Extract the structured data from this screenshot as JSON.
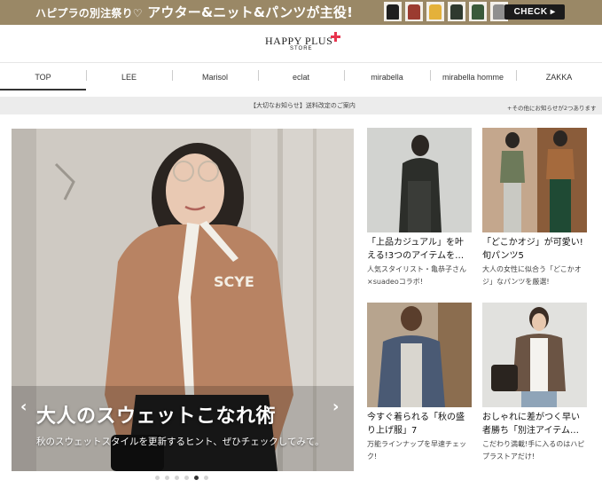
{
  "promo": {
    "lead": "ハピプラの別注祭り♡",
    "main": "アウター&ニット&パンツが主役!",
    "check_label": "CHECK ▸",
    "thumb_colors": [
      "#1f1f1f",
      "#9b3b30",
      "#e4b13a",
      "#2f3a2f",
      "#3a5a3a",
      "#8f8f8f"
    ]
  },
  "logo": {
    "main": "HAPPY PLUS",
    "sub": "STORE",
    "accent_color": "#e8344e"
  },
  "nav": {
    "items": [
      "TOP",
      "LEE",
      "Marisol",
      "eclat",
      "mirabella",
      "mirabella homme",
      "ZAKKA"
    ],
    "active": "TOP"
  },
  "notice": {
    "main": "【大切なお知らせ】送料改定のご案内",
    "more": "+その他にお知らせが2つあります"
  },
  "hero": {
    "title": "大人のスウェットこなれ術",
    "subtitle": "秋のスウェットスタイルを更新するヒント、ぜひチェックしてみて。",
    "logo_print": "SCYE",
    "slide_count": 6,
    "active_slide": 5
  },
  "cards": [
    {
      "title": "「上品カジュアル」を叶える!3つのアイテムを…",
      "desc": "人気スタイリスト・亀恭子さん×suadeoコラボ!"
    },
    {
      "title": "「どこかオジ」が可愛い! 旬パンツ5",
      "desc": "大人の女性に似合う「どこかオジ」なパンツを厳選!"
    },
    {
      "title": "今すぐ着られる「秋の盛り上げ服」7",
      "desc": "万能ラインナップを早速チェック!"
    },
    {
      "title": "おしゃれに差がつく早い者勝ち「別注アイテム…",
      "desc": "こだわり満載!手に入るのはハピプラストアだけ!"
    }
  ]
}
